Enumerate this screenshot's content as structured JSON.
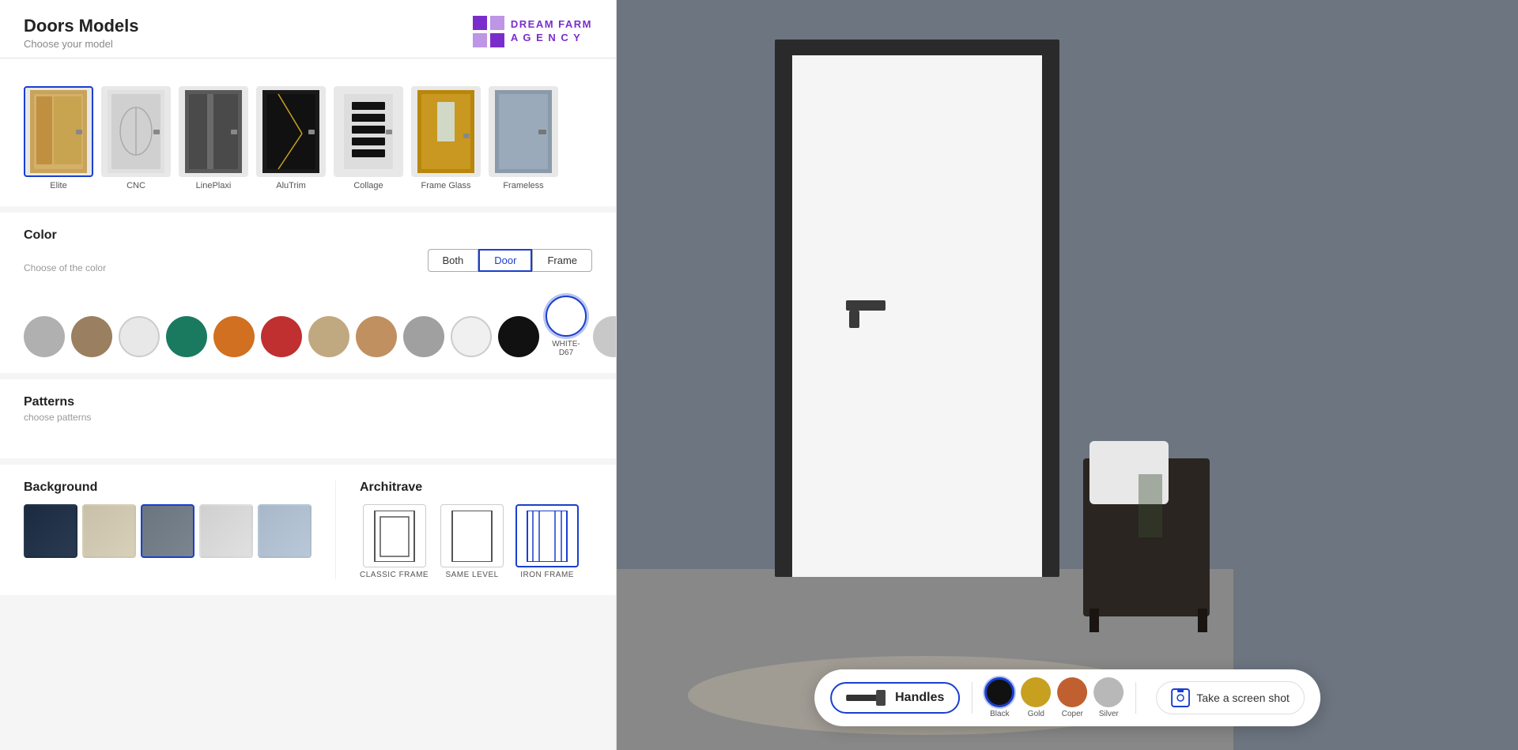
{
  "app": {
    "title": "Doors Models",
    "subtitle": "Choose your model"
  },
  "logo": {
    "line1": "DREAM FARM",
    "line2": "A G E N C Y"
  },
  "door_models": [
    {
      "id": "elite",
      "label": "Elite",
      "selected": true,
      "bg": "#c8a45a"
    },
    {
      "id": "cnc",
      "label": "CNC",
      "selected": false,
      "bg": "#d0cece"
    },
    {
      "id": "lineplaxi",
      "label": "LinePlaxi",
      "selected": false,
      "bg": "#4a4a4a"
    },
    {
      "id": "alutrim",
      "label": "AluTrim",
      "selected": false,
      "bg": "#1a1a1a"
    },
    {
      "id": "collage",
      "label": "Collage",
      "selected": false,
      "bg": "#e0e0e0"
    },
    {
      "id": "frameglass",
      "label": "Frame Glass",
      "selected": false,
      "bg": "#b8860b"
    },
    {
      "id": "frameless",
      "label": "Frameless",
      "selected": false,
      "bg": "#8a9aaa"
    }
  ],
  "color_section": {
    "title": "Color",
    "subtitle": "Choose of the color",
    "toggle_options": [
      "Both",
      "Door",
      "Frame"
    ],
    "active_toggle": "Door",
    "swatches": [
      {
        "id": "s1",
        "color": "#b0b0b0",
        "label": "",
        "selected": false
      },
      {
        "id": "s2",
        "color": "#9a8060",
        "label": "",
        "selected": false
      },
      {
        "id": "s3",
        "color": "#e8e8e8",
        "label": "",
        "selected": false
      },
      {
        "id": "s4",
        "color": "#1a7a60",
        "label": "",
        "selected": false
      },
      {
        "id": "s5",
        "color": "#d07020",
        "label": "",
        "selected": false
      },
      {
        "id": "s6",
        "color": "#c03030",
        "label": "",
        "selected": false
      },
      {
        "id": "s7",
        "color": "#c0a880",
        "label": "",
        "selected": false
      },
      {
        "id": "s8",
        "color": "#c09060",
        "label": "",
        "selected": false
      },
      {
        "id": "s9",
        "color": "#a0a0a0",
        "label": "",
        "selected": false
      },
      {
        "id": "s10",
        "color": "#f0f0f0",
        "label": "",
        "selected": false
      },
      {
        "id": "s11",
        "color": "#111111",
        "label": "",
        "selected": false
      },
      {
        "id": "s12",
        "color": "#ffffff",
        "label": "WHITE-D67",
        "selected": true
      },
      {
        "id": "s13",
        "color": "#c8c8c8",
        "label": "",
        "selected": false
      }
    ]
  },
  "patterns_section": {
    "title": "Patterns",
    "subtitle": "choose patterns"
  },
  "background_section": {
    "title": "Background",
    "thumbs": [
      {
        "id": "bg1",
        "color": "#1a2a40",
        "selected": false
      },
      {
        "id": "bg2",
        "color": "#c8c0a8",
        "selected": false
      },
      {
        "id": "bg3",
        "color": "#6a7580",
        "selected": true
      },
      {
        "id": "bg4",
        "color": "#d8d8d8",
        "selected": false
      },
      {
        "id": "bg5",
        "color": "#a8b8c8",
        "selected": false
      }
    ]
  },
  "architrave_section": {
    "title": "Architrave",
    "options": [
      {
        "id": "classic",
        "label": "CLASSIC FRAME",
        "selected": false
      },
      {
        "id": "samelevel",
        "label": "SAME LEVEL",
        "selected": false
      },
      {
        "id": "ironframe",
        "label": "IRON FRAME",
        "selected": true
      }
    ]
  },
  "toolbar": {
    "handles_label": "Handles",
    "handle_colors": [
      {
        "id": "black",
        "color": "#111111",
        "label": "Black",
        "selected": true
      },
      {
        "id": "gold",
        "color": "#c8a020",
        "label": "Gold",
        "selected": false
      },
      {
        "id": "coper",
        "color": "#c06030",
        "label": "Coper",
        "selected": false
      },
      {
        "id": "silver",
        "color": "#b8b8b8",
        "label": "Silver",
        "selected": false
      }
    ],
    "screenshot_label": "Take a screen shot"
  }
}
